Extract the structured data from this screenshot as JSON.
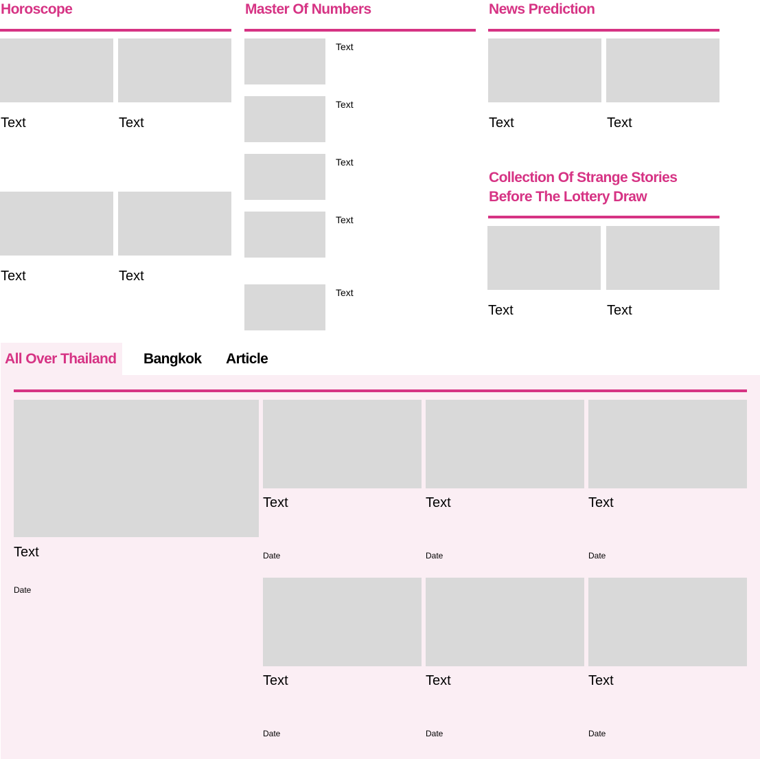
{
  "horoscope": {
    "title": "Horoscope",
    "cards": [
      {
        "caption": "Text"
      },
      {
        "caption": "Text"
      },
      {
        "caption": "Text"
      },
      {
        "caption": "Text"
      }
    ]
  },
  "master_of_numbers": {
    "title": "Master Of Numbers",
    "items": [
      {
        "caption": "Text"
      },
      {
        "caption": "Text"
      },
      {
        "caption": "Text"
      },
      {
        "caption": "Text"
      },
      {
        "caption": "Text"
      }
    ]
  },
  "news_prediction": {
    "title": "News Prediction",
    "cards": [
      {
        "caption": "Text"
      },
      {
        "caption": "Text"
      }
    ]
  },
  "strange_stories": {
    "title": "Collection Of Strange Stories Before The Lottery Draw",
    "cards": [
      {
        "caption": "Text"
      },
      {
        "caption": "Text"
      }
    ]
  },
  "tabs": [
    {
      "label": "All Over Thailand",
      "active": true
    },
    {
      "label": "Bangkok",
      "active": false
    },
    {
      "label": "Article",
      "active": false
    }
  ],
  "feed": {
    "featured": {
      "caption": "Text",
      "date": "Date"
    },
    "items": [
      {
        "caption": "Text",
        "date": "Date"
      },
      {
        "caption": "Text",
        "date": "Date"
      },
      {
        "caption": "Text",
        "date": "Date"
      },
      {
        "caption": "Text",
        "date": "Date"
      },
      {
        "caption": "Text",
        "date": "Date"
      },
      {
        "caption": "Text",
        "date": "Date"
      }
    ]
  },
  "colors": {
    "accent": "#d63384",
    "placeholder": "#d9d9d9",
    "panel_background": "#fbeef4"
  }
}
